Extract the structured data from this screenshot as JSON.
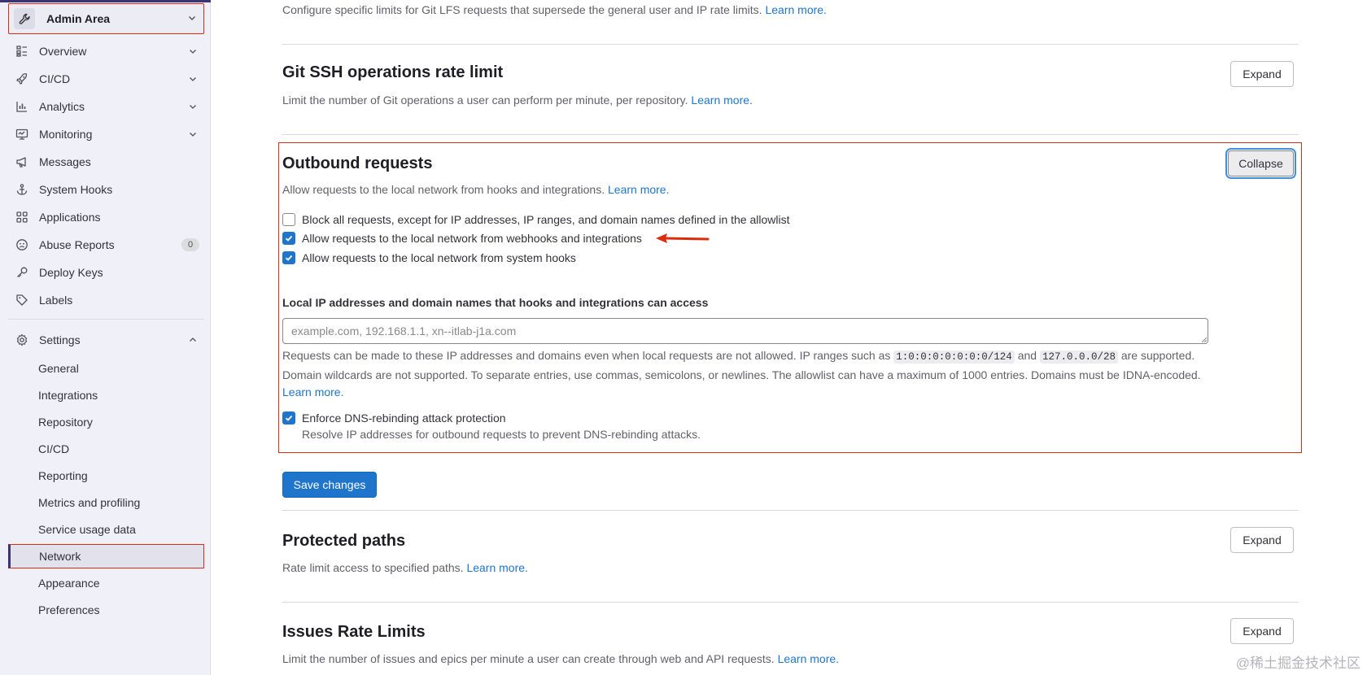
{
  "sidebar": {
    "header": {
      "title": "Admin Area"
    },
    "items": [
      {
        "label": "Overview",
        "icon": "overview-icon"
      },
      {
        "label": "CI/CD",
        "icon": "rocket-icon"
      },
      {
        "label": "Analytics",
        "icon": "chart-icon"
      },
      {
        "label": "Monitoring",
        "icon": "monitor-icon"
      },
      {
        "label": "Messages",
        "icon": "bullhorn-icon"
      },
      {
        "label": "System Hooks",
        "icon": "anchor-icon"
      },
      {
        "label": "Applications",
        "icon": "applications-icon"
      },
      {
        "label": "Abuse Reports",
        "icon": "smiley-icon",
        "badge": "0"
      },
      {
        "label": "Deploy Keys",
        "icon": "key-icon"
      },
      {
        "label": "Labels",
        "icon": "label-icon"
      },
      {
        "label": "Settings",
        "icon": "gear-icon"
      }
    ],
    "settings_sub": [
      "General",
      "Integrations",
      "Repository",
      "CI/CD",
      "Reporting",
      "Metrics and profiling",
      "Service usage data",
      "Network",
      "Appearance",
      "Preferences"
    ],
    "active_sub": "Network"
  },
  "main": {
    "lfs": {
      "description": "Configure specific limits for Git LFS requests that supersede the general user and IP rate limits.",
      "learn_more": "Learn more."
    },
    "ssh": {
      "title": "Git SSH operations rate limit",
      "description": "Limit the number of Git operations a user can perform per minute, per repository.",
      "learn_more": "Learn more.",
      "button": "Expand"
    },
    "outbound": {
      "title": "Outbound requests",
      "description": "Allow requests to the local network from hooks and integrations.",
      "learn_more": "Learn more.",
      "button": "Collapse",
      "checkboxes": [
        {
          "label": "Block all requests, except for IP addresses, IP ranges, and domain names defined in the allowlist",
          "checked": false
        },
        {
          "label": "Allow requests to the local network from webhooks and integrations",
          "checked": true
        },
        {
          "label": "Allow requests to the local network from system hooks",
          "checked": true
        }
      ],
      "allowlist_label": "Local IP addresses and domain names that hooks and integrations can access",
      "allowlist_placeholder": "example.com, 192.168.1.1, xn--itlab-j1a.com",
      "help_1": "Requests can be made to these IP addresses and domains even when local requests are not allowed. IP ranges such as",
      "code_1": "1:0:0:0:0:0:0:0/124",
      "help_and": "and",
      "code_2": "127.0.0.0/28",
      "help_2": "are supported. Domain wildcards are not supported. To separate entries, use commas, semicolons, or newlines. The allowlist can have a maximum of 1000 entries. Domains must be IDNA-encoded.",
      "help_learn_more": "Learn more.",
      "dns": {
        "label": "Enforce DNS-rebinding attack protection",
        "help": "Resolve IP addresses for outbound requests to prevent DNS-rebinding attacks.",
        "checked": true
      }
    },
    "save_button": "Save changes",
    "protected": {
      "title": "Protected paths",
      "description": "Rate limit access to specified paths.",
      "learn_more": "Learn more.",
      "button": "Expand"
    },
    "issues": {
      "title": "Issues Rate Limits",
      "description": "Limit the number of issues and epics per minute a user can create through web and API requests.",
      "learn_more": "Learn more.",
      "button": "Expand"
    }
  },
  "watermark": "@稀土掘金技术社区",
  "colors": {
    "accent": "#1f75cb",
    "highlight": "#dd2b0e",
    "sidebar_bg": "#f0f0f8"
  }
}
